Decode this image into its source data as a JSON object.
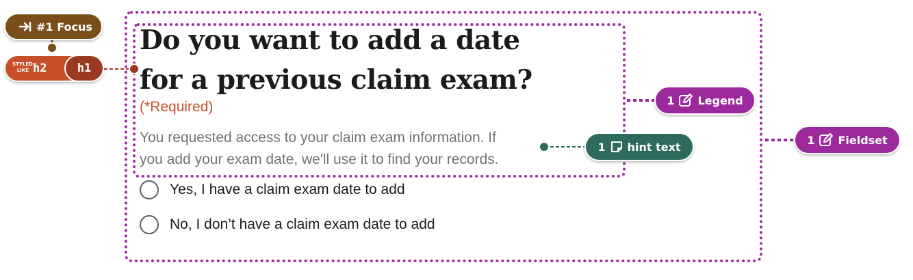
{
  "form": {
    "heading_line1": "Do you want to add a date",
    "heading_line2": "for a previous claim exam?",
    "required": "(*Required)",
    "hint_line1": "You requested access to your claim exam information. If",
    "hint_line2": "you add your exam date, we'll use it to find your records.",
    "options": [
      {
        "label": "Yes, I have a claim exam date to add"
      },
      {
        "label": "No, I don’t have a claim exam date to add"
      }
    ]
  },
  "annotations": {
    "focus": {
      "icon": "tab-arrow-icon",
      "label": "#1 Focus",
      "color": "#7a4e19"
    },
    "heading_level": {
      "styled_prefix_line1": "STYLED",
      "styled_prefix_line2": "LIKE",
      "styled_as": "h2",
      "actual": "h1",
      "color_styled": "#c7502a",
      "color_actual": "#9b3a22"
    },
    "legend": {
      "count": "1",
      "icon": "edit-icon",
      "label": "Legend",
      "color": "#9c2a9c"
    },
    "hint": {
      "count": "1",
      "icon": "note-icon",
      "label": "hint text",
      "color": "#2e6b5e"
    },
    "fieldset": {
      "count": "1",
      "icon": "edit-icon",
      "label": "Fieldset",
      "color": "#9c2a9c"
    }
  }
}
